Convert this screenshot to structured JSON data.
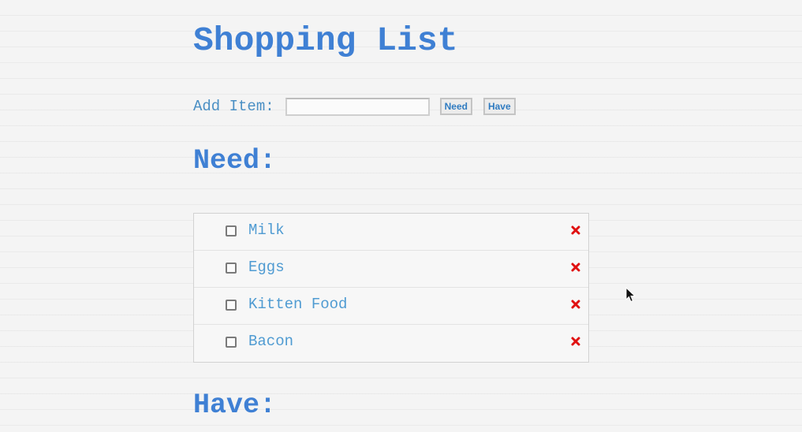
{
  "page": {
    "title": "Shopping List"
  },
  "add_item": {
    "label": "Add Item:",
    "input_value": "",
    "input_placeholder": "",
    "need_button": "Need",
    "have_button": "Have"
  },
  "need_section": {
    "title": "Need:",
    "items": [
      {
        "label": "Milk",
        "checked": false
      },
      {
        "label": "Eggs",
        "checked": false
      },
      {
        "label": "Kitten Food",
        "checked": false
      },
      {
        "label": "Bacon",
        "checked": false
      }
    ]
  },
  "have_section": {
    "title": "Have:"
  },
  "colors": {
    "heading": "#3f80d4",
    "item_text": "#4f9bd2",
    "delete": "#e01010"
  },
  "icons": {
    "delete": "close-icon",
    "checkbox": "checkbox-icon",
    "cursor": "mouse-cursor-icon"
  }
}
